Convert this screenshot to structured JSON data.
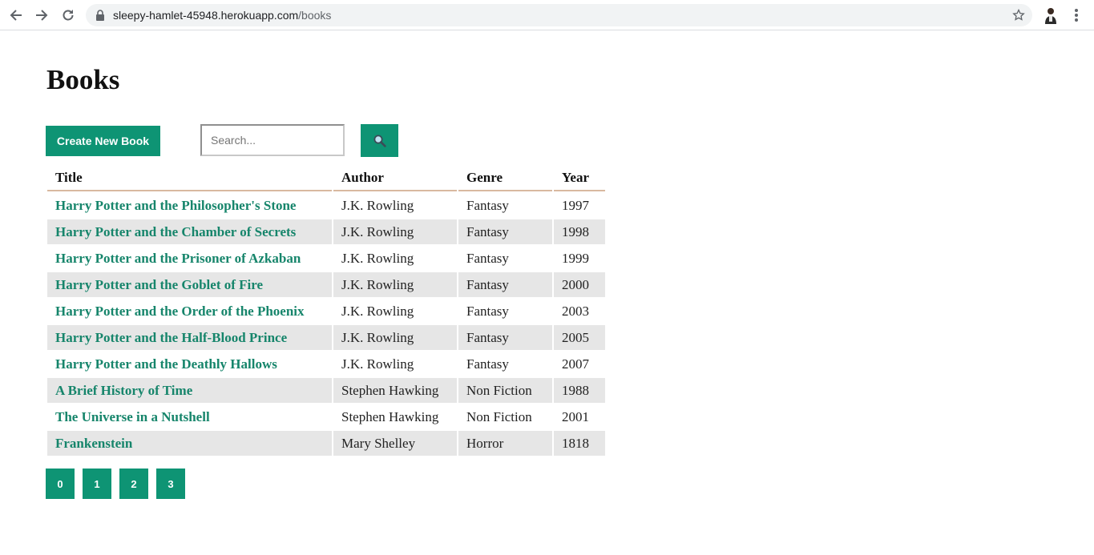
{
  "browser": {
    "url_host": "sleepy-hamlet-45948.herokuapp.com",
    "url_path": "/books"
  },
  "page": {
    "title": "Books"
  },
  "toolbar": {
    "create_label": "Create New Book",
    "search_placeholder": "Search...",
    "search_value": "",
    "search_icon": "magnifier-icon"
  },
  "table": {
    "headers": [
      "Title",
      "Author",
      "Genre",
      "Year"
    ],
    "rows": [
      {
        "title": "Harry Potter and the Philosopher's Stone",
        "author": "J.K. Rowling",
        "genre": "Fantasy",
        "year": "1997"
      },
      {
        "title": "Harry Potter and the Chamber of Secrets",
        "author": "J.K. Rowling",
        "genre": "Fantasy",
        "year": "1998"
      },
      {
        "title": "Harry Potter and the Prisoner of Azkaban",
        "author": "J.K. Rowling",
        "genre": "Fantasy",
        "year": "1999"
      },
      {
        "title": "Harry Potter and the Goblet of Fire",
        "author": "J.K. Rowling",
        "genre": "Fantasy",
        "year": "2000"
      },
      {
        "title": "Harry Potter and the Order of the Phoenix",
        "author": "J.K. Rowling",
        "genre": "Fantasy",
        "year": "2003"
      },
      {
        "title": "Harry Potter and the Half-Blood Prince",
        "author": "J.K. Rowling",
        "genre": "Fantasy",
        "year": "2005"
      },
      {
        "title": "Harry Potter and the Deathly Hallows",
        "author": "J.K. Rowling",
        "genre": "Fantasy",
        "year": "2007"
      },
      {
        "title": "A Brief History of Time",
        "author": "Stephen Hawking",
        "genre": "Non Fiction",
        "year": "1988"
      },
      {
        "title": "The Universe in a Nutshell",
        "author": "Stephen Hawking",
        "genre": "Non Fiction",
        "year": "2001"
      },
      {
        "title": "Frankenstein",
        "author": "Mary Shelley",
        "genre": "Horror",
        "year": "1818"
      }
    ]
  },
  "pagination": {
    "pages": [
      "0",
      "1",
      "2",
      "3"
    ]
  },
  "colors": {
    "accent": "#0e9474",
    "link": "#16856b",
    "row_alt": "#e6e6e6",
    "header_rule": "#d9b9a0"
  }
}
